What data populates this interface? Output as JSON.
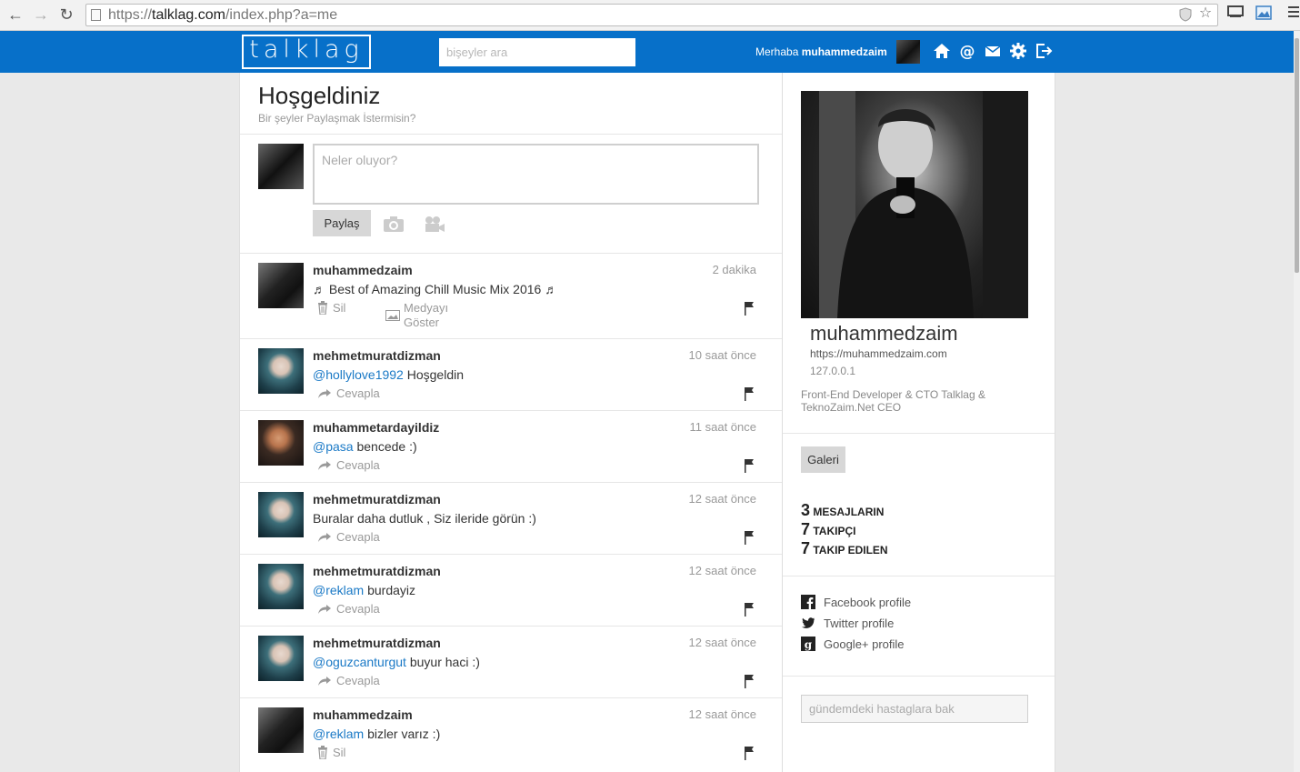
{
  "browser": {
    "url_scheme": "https://",
    "url_host": "talklag.com",
    "url_path": "/index.php?a=me"
  },
  "header": {
    "logo": "talklag",
    "search_placeholder": "bişeyler ara",
    "greeting": "Merhaba",
    "username": "muhammedzaim",
    "icons": [
      "home-icon",
      "mention-icon",
      "mail-icon",
      "settings-icon",
      "logout-icon"
    ],
    "accent_color": "#0770c9"
  },
  "welcome": {
    "title": "Hoşgeldiniz",
    "subtitle": "Bir şeyler Paylaşmak İstermisin?"
  },
  "compose": {
    "placeholder": "Neler oluyor?",
    "share_label": "Paylaş"
  },
  "posts": [
    {
      "user": "muhammedzaim",
      "time": "2 dakika",
      "mention": "",
      "text": "♬ Best of Amazing Chill Music Mix 2016 ♬",
      "action": "Sil",
      "action2": "Medyayı Göster"
    },
    {
      "user": "mehmetmuratdizman",
      "time": "10 saat önce",
      "mention": "@hollylove1992",
      "text": " Hoşgeldin",
      "action": "Cevapla"
    },
    {
      "user": "muhammetardayildiz",
      "time": "11 saat önce",
      "mention": "@pasa",
      "text": " bencede :)",
      "action": "Cevapla"
    },
    {
      "user": "mehmetmuratdizman",
      "time": "12 saat önce",
      "mention": "",
      "text": "Buralar daha dutluk , Siz ileride görün :)",
      "action": "Cevapla"
    },
    {
      "user": "mehmetmuratdizman",
      "time": "12 saat önce",
      "mention": "@reklam",
      "text": " burdayiz",
      "action": "Cevapla"
    },
    {
      "user": "mehmetmuratdizman",
      "time": "12 saat önce",
      "mention": "@oguzcanturgut",
      "text": " buyur haci :)",
      "action": "Cevapla"
    },
    {
      "user": "muhammedzaim",
      "time": "12 saat önce",
      "mention": "@reklam",
      "text": " bizler varız :)",
      "action": "Sil"
    }
  ],
  "profile": {
    "name": "muhammedzaim",
    "url": "https://muhammedzaim.com",
    "ip": "127.0.0.1",
    "bio": "Front-End Developer & CTO Talklag & TeknoZaim.Net CEO",
    "gallery_label": "Galeri",
    "stats": [
      {
        "num": "3",
        "label": "Mesajların"
      },
      {
        "num": "7",
        "label": "Takipçi"
      },
      {
        "num": "7",
        "label": "Takip Edilen"
      }
    ],
    "social": [
      {
        "label": "Facebook profile",
        "icon": "facebook-icon"
      },
      {
        "label": "Twitter profile",
        "icon": "twitter-icon"
      },
      {
        "label": "Google+ profile",
        "icon": "google-plus-icon"
      }
    ],
    "trend_placeholder": "gündemdeki hastaglara bak"
  }
}
